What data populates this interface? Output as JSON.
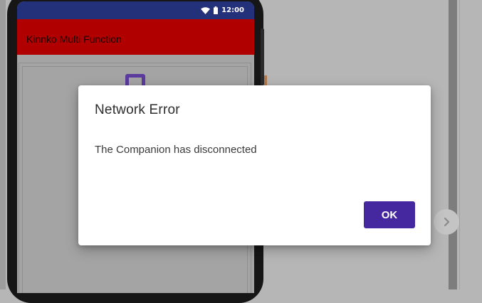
{
  "phone": {
    "status_bar": {
      "time": "12:00",
      "icons": [
        "wifi-icon",
        "battery-icon"
      ]
    },
    "app_title": "Kinnko Multi Function"
  },
  "dialog": {
    "title": "Network Error",
    "message": "The Companion has disconnected",
    "ok_label": "OK"
  },
  "colors": {
    "status_bar": "#23307a",
    "app_bar": "#b00000",
    "ok_button": "#4527a0",
    "overlay_background": "#b6b6b6"
  }
}
